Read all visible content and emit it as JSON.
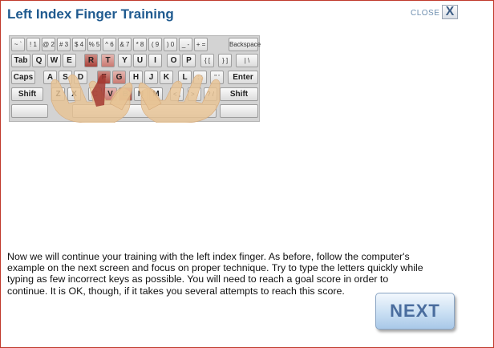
{
  "header": {
    "title": "Left Index Finger Training",
    "close_label": "CLOSE",
    "close_icon_glyph": "X"
  },
  "keyboard": {
    "row1": [
      "~ `",
      "! 1",
      "@ 2",
      "# 3",
      "$ 4",
      "% 5",
      "^ 6",
      "& 7",
      "* 8",
      "( 9",
      ") 0",
      "_ -",
      "+ =",
      "Backspace"
    ],
    "row2": [
      "Tab",
      "Q",
      "W",
      "E",
      "R",
      "T",
      "Y",
      "U",
      "I",
      "O",
      "P",
      "{ [",
      "} ]",
      "| \\"
    ],
    "row3": [
      "Caps",
      "A",
      "S",
      "D",
      "F",
      "G",
      "H",
      "J",
      "K",
      "L",
      ": ;",
      "\" '",
      "Enter"
    ],
    "row4": [
      "Shift",
      "Z",
      "X",
      "C",
      "V",
      "B",
      "N",
      "M",
      "< ,",
      "> .",
      "? /",
      "Shift"
    ],
    "highlighted_keys": [
      "R",
      "T",
      "F",
      "G",
      "V",
      "B"
    ]
  },
  "instructions": "Now we will continue your training with the left index finger. As before, follow the computer's example on the next screen and focus on proper technique. Try to type the letters quickly while typing as few incorrect keys as possible. You will need to reach a goal score in order to continue. It is OK, though, if it takes you several attempts to reach this score.",
  "next_button": {
    "label": "NEXT"
  },
  "colors": {
    "title": "#1f5a8f",
    "border": "#c0392b",
    "highlight": "#c97a72"
  }
}
